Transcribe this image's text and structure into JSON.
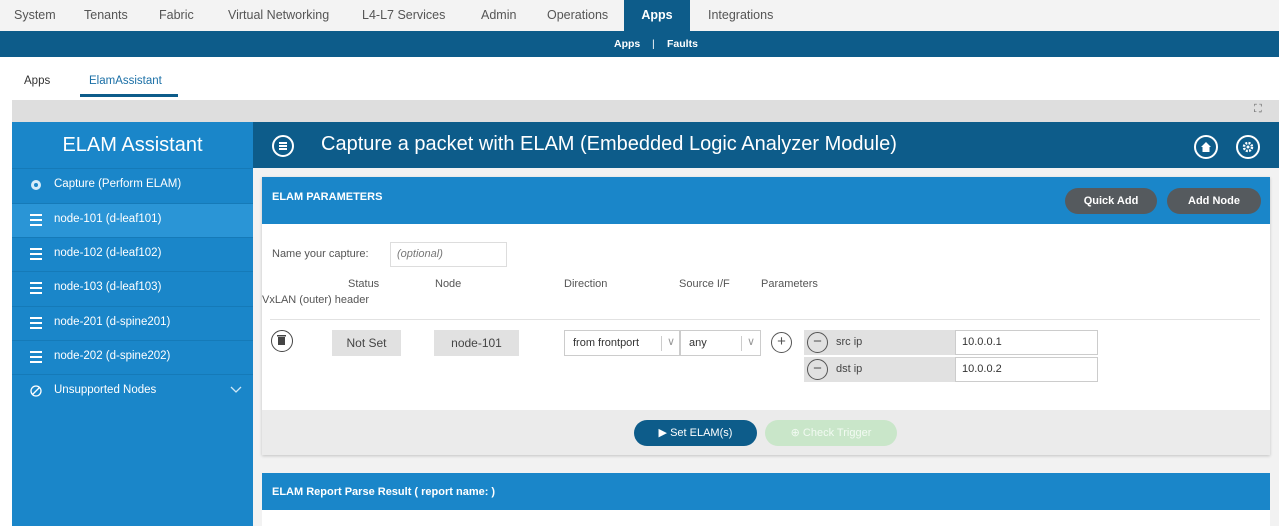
{
  "topnav": {
    "items": [
      "System",
      "Tenants",
      "Fabric",
      "Virtual Networking",
      "L4-L7 Services",
      "Admin",
      "Operations",
      "Apps",
      "Integrations"
    ],
    "active": "Apps"
  },
  "subnav": {
    "apps": "Apps",
    "separator": "|",
    "faults": "Faults"
  },
  "apptabs": {
    "apps": "Apps",
    "elam": "ElamAssistant"
  },
  "sidebar": {
    "title": "ELAM Assistant",
    "items": [
      {
        "label": "Capture (Perform ELAM)",
        "icon": "capture-icon"
      },
      {
        "label": "node-101 (d-leaf101)",
        "icon": "server-icon"
      },
      {
        "label": "node-102 (d-leaf102)",
        "icon": "server-icon"
      },
      {
        "label": "node-103 (d-leaf103)",
        "icon": "server-icon"
      },
      {
        "label": "node-201 (d-spine201)",
        "icon": "server-icon"
      },
      {
        "label": "node-202 (d-spine202)",
        "icon": "server-icon"
      },
      {
        "label": "Unsupported Nodes",
        "icon": "unsupported-icon"
      }
    ]
  },
  "main": {
    "title": "Capture a packet with ELAM (Embedded Logic Analyzer Module)",
    "home_icon": "home-icon",
    "settings_icon": "gear-icon"
  },
  "params": {
    "header": "ELAM PARAMETERS",
    "quick_add": "Quick Add",
    "add_node": "Add Node",
    "name_label": "Name your capture:",
    "name_placeholder": "(optional)",
    "columns": {
      "status": "Status",
      "node": "Node",
      "direction": "Direction",
      "source": "Source I/F",
      "parameters": "Parameters",
      "vxlan": "VxLAN (outer) header"
    },
    "row": {
      "status": "Not Set",
      "node": "node-101",
      "direction": "from frontport",
      "source": "any",
      "params": [
        {
          "name": "src ip",
          "value": "10.0.0.1"
        },
        {
          "name": "dst ip",
          "value": "10.0.0.2"
        }
      ]
    },
    "set_elam": "Set ELAM(s)",
    "check_trigger": "Check Trigger"
  },
  "report": {
    "title": "ELAM Report Parse Result ( report name: )"
  }
}
